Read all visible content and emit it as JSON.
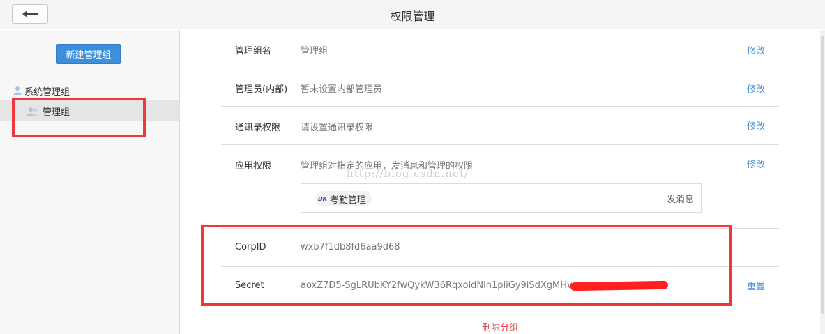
{
  "header": {
    "title": "权限管理",
    "back_icon": "arrow-left-icon"
  },
  "sidebar": {
    "new_group_label": "新建管理组",
    "tree_root": {
      "label": "系统管理组",
      "icon": "user-icon"
    },
    "tree_child": {
      "label": "管理组",
      "icon": "users-icon"
    }
  },
  "rows": {
    "group_name": {
      "label": "管理组名",
      "value": "管理组",
      "action": "修改"
    },
    "admins": {
      "label": "管理员(内部)",
      "value": "暂未设置内部管理员",
      "action": "修改"
    },
    "contacts": {
      "label": "通讯录权限",
      "value": "请设置通讯录权限",
      "action": "修改"
    },
    "apps": {
      "label": "应用权限",
      "value": "管理组对指定的应用，发消息和管理的权限",
      "action": "修改",
      "app_logo": "DK",
      "app_name": "考勤管理",
      "app_send": "发消息"
    },
    "corpid": {
      "label": "CorpID",
      "value": "wxb7f1db8fd6aa9d68"
    },
    "secret": {
      "label": "Secret",
      "value": "aoxZ7D5-SgLRUbKY2fwQykW36RqxoldNln1pliGy9iSdXgMHv",
      "action": "重置"
    }
  },
  "watermark": "http://blog.csdn.net/",
  "delete_label": "删除分组",
  "colors": {
    "accent": "#3d8fdc",
    "link": "#4a8ed6",
    "highlight": "#f0373c",
    "danger": "#e04040"
  }
}
